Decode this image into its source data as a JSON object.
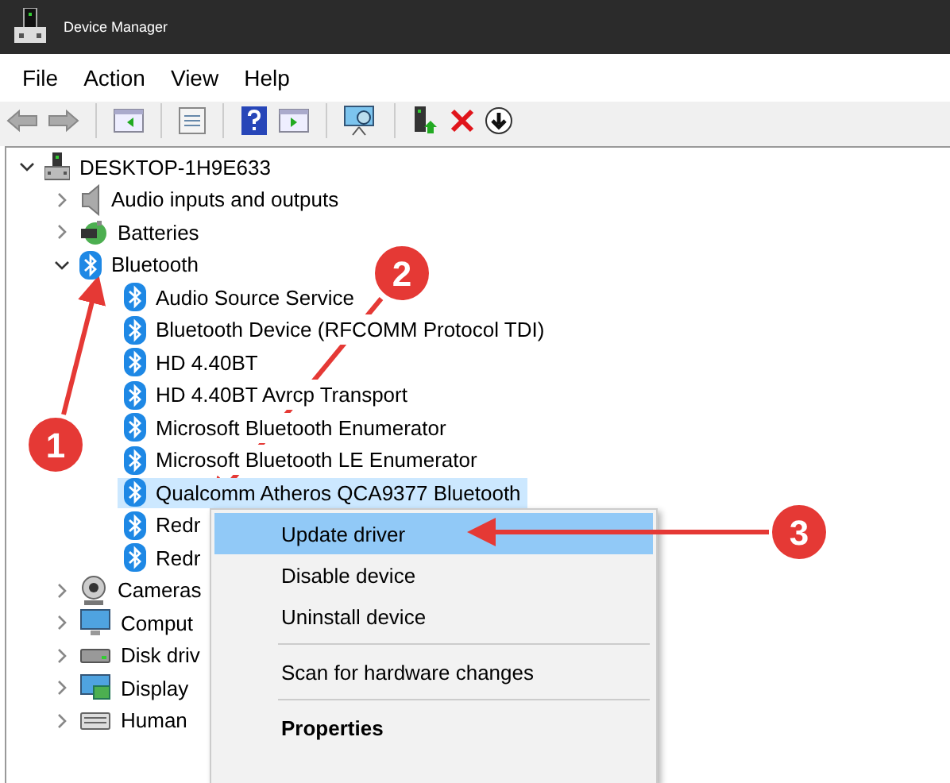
{
  "window": {
    "title": "Device Manager"
  },
  "menu": [
    "File",
    "Action",
    "View",
    "Help"
  ],
  "toolbar": [
    {
      "kind": "back"
    },
    {
      "kind": "forward"
    },
    {
      "kind": "separator"
    },
    {
      "kind": "pane-left"
    },
    {
      "kind": "separator"
    },
    {
      "kind": "properties"
    },
    {
      "kind": "separator"
    },
    {
      "kind": "help"
    },
    {
      "kind": "pane-right"
    },
    {
      "kind": "separator"
    },
    {
      "kind": "scan"
    },
    {
      "kind": "separator"
    },
    {
      "kind": "update"
    },
    {
      "kind": "remove"
    },
    {
      "kind": "download"
    }
  ],
  "tree": {
    "label": "DESKTOP-1H9E633",
    "kind": "computer",
    "expanded": true,
    "children": [
      {
        "label": "Audio inputs and outputs",
        "kind": "audio",
        "expanded": false
      },
      {
        "label": "Batteries",
        "kind": "battery",
        "expanded": false
      },
      {
        "label": "Bluetooth",
        "kind": "bluetooth",
        "expanded": true,
        "children": [
          {
            "label": "Audio Source Service",
            "kind": "bluetooth",
            "selected": false
          },
          {
            "label": "Bluetooth Device (RFCOMM Protocol TDI)",
            "kind": "bluetooth",
            "selected": false
          },
          {
            "label": "HD 4.40BT",
            "kind": "bluetooth",
            "selected": false
          },
          {
            "label": "HD 4.40BT Avrcp Transport",
            "kind": "bluetooth",
            "selected": false
          },
          {
            "label": "Microsoft Bluetooth Enumerator",
            "kind": "bluetooth",
            "selected": false
          },
          {
            "label": "Microsoft Bluetooth LE Enumerator",
            "kind": "bluetooth",
            "selected": false
          },
          {
            "label": "Qualcomm Atheros QCA9377 Bluetooth",
            "kind": "bluetooth",
            "selected": true
          },
          {
            "label": "Redr",
            "kind": "bluetooth",
            "selected": false
          },
          {
            "label": "Redr",
            "kind": "bluetooth",
            "selected": false
          }
        ]
      },
      {
        "label": "Cameras",
        "kind": "camera",
        "expanded": false
      },
      {
        "label": "Comput",
        "kind": "monitor",
        "expanded": false
      },
      {
        "label": "Disk driv",
        "kind": "disk",
        "expanded": false
      },
      {
        "label": "Display",
        "kind": "display",
        "expanded": false
      },
      {
        "label": "Human",
        "kind": "keyboard",
        "expanded": false
      }
    ]
  },
  "context_menu": [
    {
      "label": "Update driver",
      "selected": true,
      "bold": false,
      "separator_before": false
    },
    {
      "label": "Disable device",
      "selected": false,
      "bold": false,
      "separator_before": false
    },
    {
      "label": "Uninstall device",
      "selected": false,
      "bold": false,
      "separator_before": false
    },
    {
      "label": "Scan for hardware changes",
      "selected": false,
      "bold": false,
      "separator_before": true
    },
    {
      "label": "Properties",
      "selected": false,
      "bold": true,
      "separator_before": true
    }
  ],
  "annotations": [
    {
      "label": "1"
    },
    {
      "label": "2"
    },
    {
      "label": "3"
    }
  ]
}
